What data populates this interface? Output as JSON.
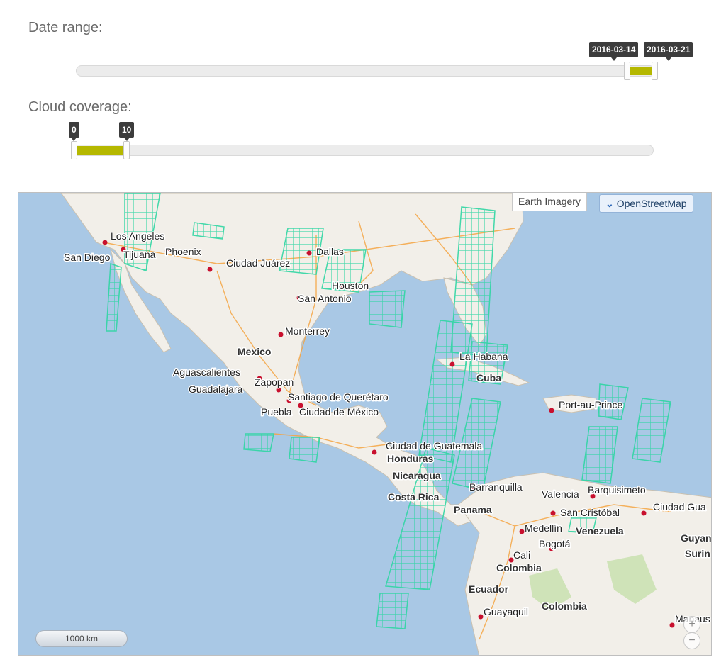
{
  "date_range": {
    "label": "Date range:",
    "min_label": "2016-03-14",
    "max_label": "2016-03-21"
  },
  "cloud_coverage": {
    "label": "Cloud coverage:",
    "min_label": "0",
    "max_label": "10"
  },
  "map": {
    "layers": {
      "earth_imagery": "Earth Imagery",
      "openstreetmap": "OpenStreetMap"
    },
    "scale": "1000 km",
    "zoom_in": "+",
    "zoom_out": "−",
    "cities": {
      "los_angeles": "Los Angeles",
      "san_diego": "San Diego",
      "tijuana": "Tijuana",
      "phoenix": "Phoenix",
      "ciudad_juarez": "Ciudad Juárez",
      "dallas": "Dallas",
      "houston": "Houston",
      "san_antonio": "San Antonio",
      "monterrey": "Monterrey",
      "aguascalientes": "Aguascalientes",
      "zapopan": "Zapopan",
      "guadalajara": "Guadalajara",
      "queretaro": "Santiago de Querétaro",
      "puebla": "Puebla",
      "ciudad_mexico": "Ciudad de México",
      "la_habana": "La Habana",
      "port_au_prince": "Port-au-Prince",
      "guatemala": "Ciudad de Guatemala",
      "barranquilla": "Barranquilla",
      "valencia": "Valencia",
      "barquisimeto": "Barquisimeto",
      "ciudad_guayana": "Ciudad Gua",
      "san_cristobal": "San Cristóbal",
      "medellin": "Medellín",
      "bogota": "Bogotá",
      "cali": "Cali",
      "guayaquil": "Guayaquil",
      "manaus": "Manaus"
    },
    "countries": {
      "mexico": "Mexico",
      "cuba": "Cuba",
      "honduras": "Honduras",
      "nicaragua": "Nicaragua",
      "costa_rica": "Costa Rica",
      "panama": "Panama",
      "venezuela": "Venezuela",
      "guyana": "Guyana",
      "suriname": "Surin",
      "colombia": "Colombia",
      "colombia2": "Colombia",
      "ecuador": "Ecuador"
    },
    "colors": {
      "ocean": "#a9c8e5",
      "land": "#f2efe9",
      "footprint": "#2fd6a3",
      "slider_fill": "#b5b800"
    }
  }
}
